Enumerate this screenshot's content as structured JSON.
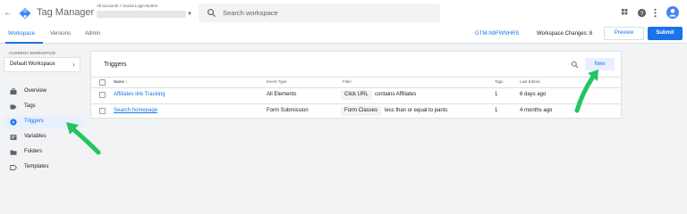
{
  "header": {
    "back_icon": "arrow-left-icon",
    "app_title": "Tag Manager",
    "account_path": "All accounts > Social Login Button",
    "search_placeholder": "Search workspace",
    "right_icons": [
      "apps-grid-icon",
      "help-icon",
      "more-vert-icon",
      "account-avatar-icon"
    ]
  },
  "subnav": {
    "tabs": [
      "Workspace",
      "Versions",
      "Admin"
    ],
    "active_tab": "Workspace",
    "container_id": "GTM-N9FWNHRS",
    "workspace_changes": "Workspace Changes: 8",
    "preview_label": "Preview",
    "submit_label": "Submit"
  },
  "sidebar": {
    "current_workspace_label": "CURRENT WORKSPACE",
    "workspace_name": "Default Workspace",
    "items": [
      {
        "label": "Overview",
        "icon": "briefcase-icon"
      },
      {
        "label": "Tags",
        "icon": "tag-icon"
      },
      {
        "label": "Triggers",
        "icon": "trigger-icon",
        "active": true
      },
      {
        "label": "Variables",
        "icon": "variables-icon"
      },
      {
        "label": "Folders",
        "icon": "folder-icon"
      },
      {
        "label": "Templates",
        "icon": "template-icon"
      }
    ]
  },
  "triggers": {
    "title": "Triggers",
    "new_label": "New",
    "columns": {
      "name": "Name ↑",
      "event_type": "Event Type",
      "filter": "Filter",
      "tags": "Tags",
      "last_edited": "Last Edited"
    },
    "rows": [
      {
        "name": "Affiliates link Tracking",
        "event_type": "All Elements",
        "filter_var": "Click URL",
        "filter_rest": "contains Affiliates",
        "tags": "1",
        "last_edited": "6 days ago"
      },
      {
        "name": "Search homepage",
        "event_type": "Form Submission",
        "filter_var": "Form Classes",
        "filter_rest": "less than or equal to pants",
        "tags": "1",
        "last_edited": "4 months ago"
      }
    ]
  },
  "colors": {
    "accent": "#1a73e8",
    "annotation_arrow": "#22c55e",
    "sidebar_active_bg": "#e8f0fe"
  }
}
